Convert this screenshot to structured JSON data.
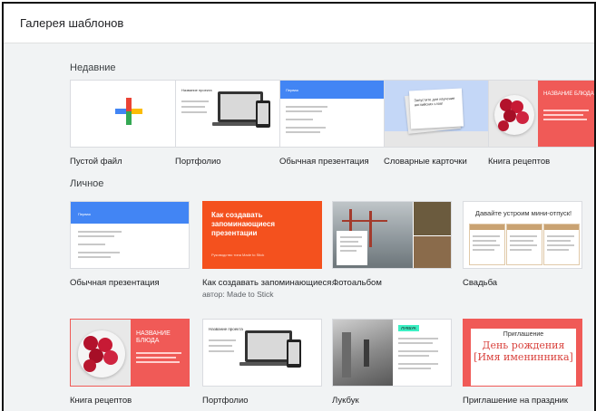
{
  "window": {
    "title": "Галерея шаблонов"
  },
  "sections": {
    "recent": {
      "title": "Недавние",
      "cards": [
        {
          "name": "blank-file",
          "caption": "Пустой файл"
        },
        {
          "name": "portfolio",
          "caption": "Портфолио",
          "thumb_title": "Название проекта"
        },
        {
          "name": "simple-presentation",
          "caption": "Обычная презентация",
          "thumb_label": "Первая"
        },
        {
          "name": "vocab-cards",
          "caption": "Словарные карточки",
          "thumb_text": "Запустите для изучения английских слов!"
        },
        {
          "name": "recipe-book",
          "caption": "Книга рецептов",
          "thumb_title": "НАЗВАНИЕ БЛЮДА"
        }
      ]
    },
    "personal": {
      "title": "Личное",
      "cards": [
        {
          "name": "simple-presentation",
          "caption": "Обычная презентация",
          "thumb_label": "Первая"
        },
        {
          "name": "memorable-presentations",
          "caption": "Как создавать запоминающиеся...",
          "author": "автор: Made to Stick",
          "thumb_title": "Как создавать запоминающиеся презентации",
          "thumb_sub": "Руководство типа Made to Stick"
        },
        {
          "name": "photo-album",
          "caption": "Фотоальбом"
        },
        {
          "name": "wedding",
          "caption": "Свадьба",
          "thumb_title": "Давайте устроим мини-отпуск!"
        },
        {
          "name": "recipe-book-2",
          "caption": "Книга рецептов",
          "thumb_title": "НАЗВАНИЕ БЛЮДА"
        },
        {
          "name": "portfolio-2",
          "caption": "Портфолио",
          "thumb_title": "Название проекта"
        },
        {
          "name": "lookbook",
          "caption": "Лукбук",
          "thumb_title": "ЛУКБУК"
        },
        {
          "name": "party-invite",
          "caption": "Приглашение на праздник",
          "thumb_small": "Приглашение",
          "thumb_big": "День рождения [Имя именинника]"
        }
      ]
    }
  },
  "colors": {
    "google_blue": "#4285f4",
    "google_red": "#ea4335",
    "google_yellow": "#fbbc05",
    "google_green": "#34a853",
    "orange": "#f4511e",
    "recipe_red": "#f05a57",
    "sky": "#c4d7f7"
  }
}
